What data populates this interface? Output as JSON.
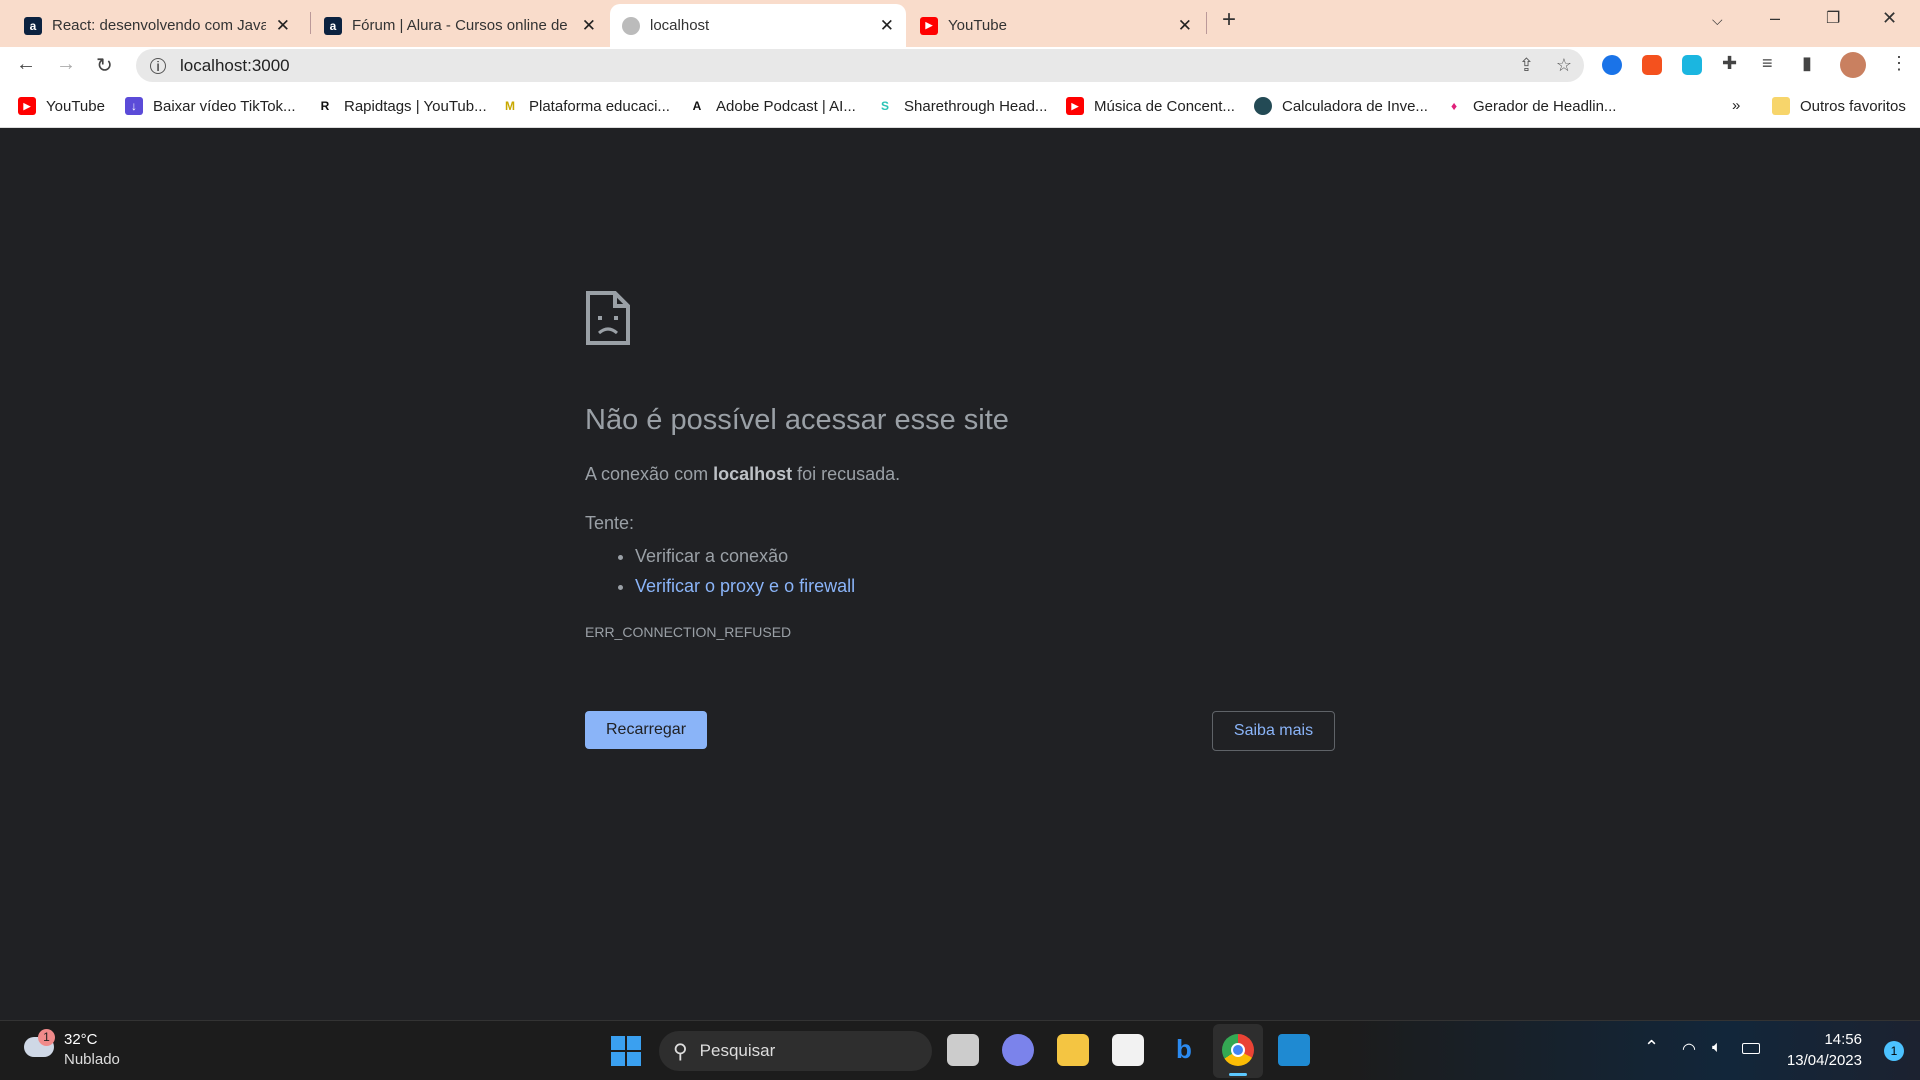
{
  "tabs": [
    {
      "title": "React: desenvolvendo com JavaScript",
      "icon": "alura-icon",
      "active": false
    },
    {
      "title": "Fórum | Alura - Cursos online de",
      "icon": "alura-icon",
      "active": false
    },
    {
      "title": "localhost",
      "icon": "globe-icon",
      "active": true
    },
    {
      "title": "YouTube",
      "icon": "youtube-icon",
      "active": false
    }
  ],
  "address": "localhost:3000",
  "bookmarks": [
    {
      "label": "YouTube",
      "color": "#ff0000"
    },
    {
      "label": "Baixar vídeo TikTok...",
      "color": "#5b4bd8"
    },
    {
      "label": "Rapidtags | YouTub...",
      "color": "#111111"
    },
    {
      "label": "Plataforma educaci...",
      "color": "#c8a800"
    },
    {
      "label": "Adobe Podcast | AI...",
      "color": "#111111"
    },
    {
      "label": "Sharethrough Head...",
      "color": "#2bc4b6"
    },
    {
      "label": "Música de Concent...",
      "color": "#ff0000"
    },
    {
      "label": "Calculadora de Inve...",
      "color": "#234a55"
    },
    {
      "label": "Gerador de Headlin...",
      "color": "#e0207a"
    }
  ],
  "bookmarks_more": "»",
  "other_bookmarks": "Outros favoritos",
  "error": {
    "title": "Não é possível acessar esse site",
    "msg_prefix": "A conexão com ",
    "host": "localhost",
    "msg_suffix": " foi recusada.",
    "try": "Tente:",
    "suggestions": [
      "Verificar a conexão",
      "Verificar o proxy e o firewall"
    ],
    "code": "ERR_CONNECTION_REFUSED",
    "reload": "Recarregar",
    "details": "Saiba mais"
  },
  "taskbar": {
    "weather_temp": "32°C",
    "weather_desc": "Nublado",
    "weather_badge": "1",
    "search": "Pesquisar",
    "time": "14:56",
    "date": "13/04/2023",
    "notifications": "1"
  },
  "colors": {
    "accent": "#8ab4f8",
    "background": "#202124",
    "tabbar": "#f9dccb"
  }
}
